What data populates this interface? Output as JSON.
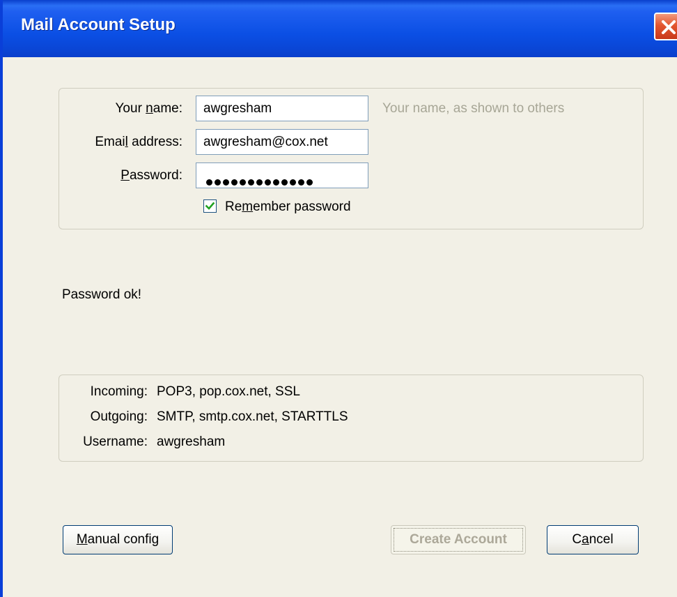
{
  "window": {
    "title": "Mail Account Setup"
  },
  "form": {
    "name_label_pre": "Your ",
    "name_label_key": "n",
    "name_label_post": "ame:",
    "name_value": "awgresham",
    "name_hint": "Your name, as shown to others",
    "email_label_pre": "Emai",
    "email_label_key": "l",
    "email_label_post": " address:",
    "email_value": "awgresham@cox.net",
    "password_label_key": "P",
    "password_label_post": "assword:",
    "password_length": 13,
    "remember_checked": true,
    "remember_label_pre": "Re",
    "remember_label_key": "m",
    "remember_label_post": "ember password"
  },
  "status": {
    "message": "Password ok!"
  },
  "config": {
    "rows": [
      {
        "label": "Incoming:",
        "value": "POP3, pop.cox.net, SSL"
      },
      {
        "label": "Outgoing:",
        "value": "SMTP, smtp.cox.net, STARTTLS"
      },
      {
        "label": "Username:",
        "value": "awgresham"
      }
    ]
  },
  "buttons": {
    "manual_key": "M",
    "manual_post": "anual config",
    "create_label": "Create Account",
    "cancel_pre": "C",
    "cancel_key": "a",
    "cancel_post": "ncel"
  },
  "colors": {
    "titlebar": "#0b4fe4",
    "window_bg": "#f2f0e6",
    "hint_text": "#a7a696",
    "checkmark": "#21a121"
  },
  "icons": {
    "close": "close-icon",
    "check": "checkmark-icon"
  }
}
